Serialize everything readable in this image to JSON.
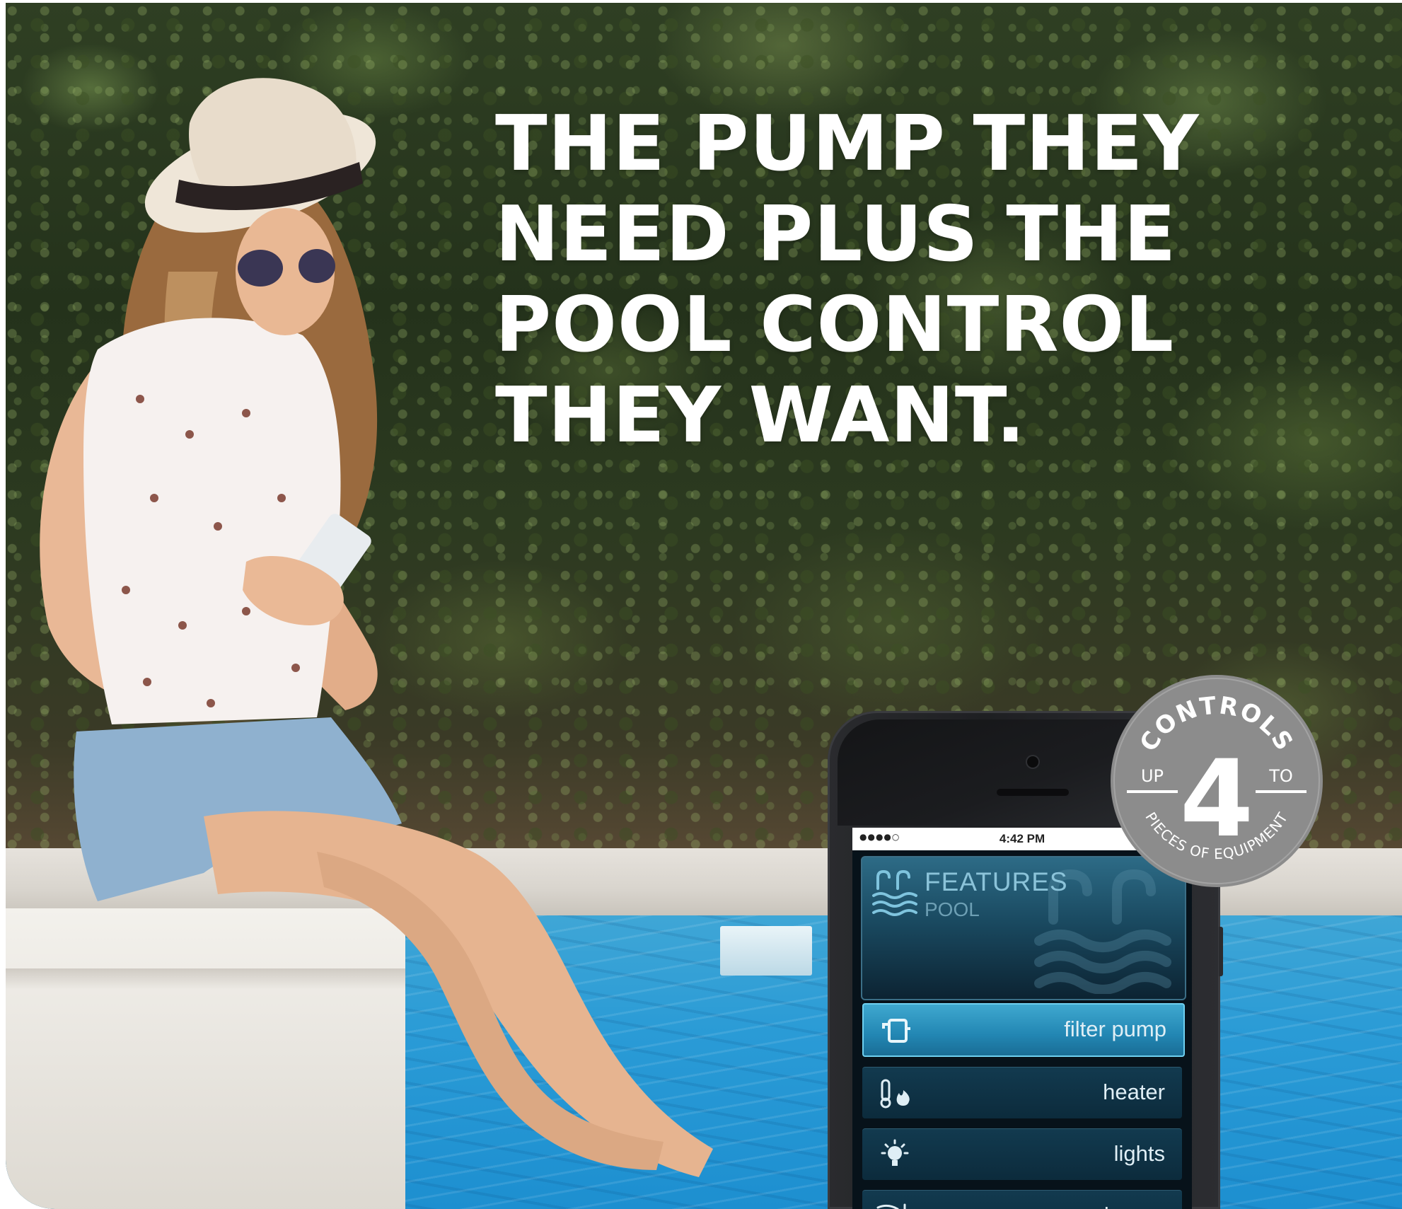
{
  "headline": {
    "lines": [
      "THE PUMP THEY",
      "NEED PLUS THE",
      "POOL CONTROL",
      "THEY WANT."
    ]
  },
  "phone": {
    "status_bar": {
      "signal": "●●●●○",
      "time": "4:42 PM",
      "right_icons": "⇾ ✱"
    },
    "features": {
      "title": "FEATURES",
      "subtitle": "POOL"
    },
    "menu": [
      {
        "label": "filter pump",
        "icon": "filter-pump-icon",
        "active": true
      },
      {
        "label": "heater",
        "icon": "heater-icon",
        "active": false
      },
      {
        "label": "lights",
        "icon": "lights-icon",
        "active": false
      },
      {
        "label": "cleaner",
        "icon": "cleaner-icon",
        "active": false
      }
    ]
  },
  "badge": {
    "arc_top": "CONTROLS",
    "left": "UP",
    "number": "4",
    "right": "TO",
    "arc_bottom": "PIECES OF EQUIPMENT",
    "color": "#8c8c8c"
  },
  "colors": {
    "headline": "#ffffff",
    "pool": "#2a9bd6",
    "hedge": "#2c3a20",
    "screen_accent": "#3fa8cf"
  }
}
